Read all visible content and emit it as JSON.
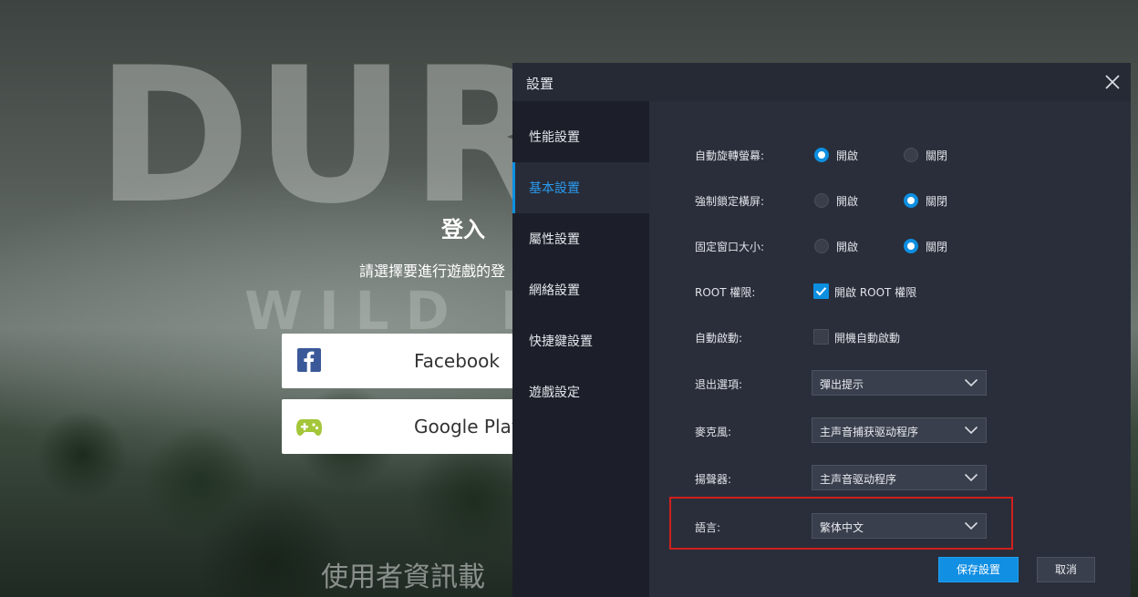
{
  "background": {
    "logo_text": "DURA",
    "logo_subtext": "WILD LA",
    "login_title": "登入",
    "login_subtitle": "請選擇要進行遊戲的登",
    "facebook_label": "Facebook",
    "google_play_label": "Google Play",
    "footer_text": "使用者資訊載"
  },
  "dialog": {
    "title": "設置",
    "sidebar": [
      {
        "label": "性能設置",
        "active": false
      },
      {
        "label": "基本設置",
        "active": true
      },
      {
        "label": "屬性設置",
        "active": false
      },
      {
        "label": "網絡設置",
        "active": false
      },
      {
        "label": "快捷鍵設置",
        "active": false
      },
      {
        "label": "遊戲設定",
        "active": false
      }
    ],
    "settings": {
      "auto_rotate": {
        "label": "自動旋轉螢幕:",
        "on": "開啟",
        "off": "關閉",
        "selected": "on"
      },
      "force_landscape": {
        "label": "強制鎖定橫屏:",
        "on": "開啟",
        "off": "關閉",
        "selected": "off"
      },
      "fixed_window": {
        "label": "固定窗口大小:",
        "on": "開啟",
        "off": "關閉",
        "selected": "off"
      },
      "root": {
        "label": "ROOT 權限:",
        "option": "開啟 ROOT 權限",
        "checked": true
      },
      "autostart": {
        "label": "自動啟動:",
        "option": "開機自動啟動",
        "checked": false
      },
      "exit_option": {
        "label": "退出選項:",
        "value": "彈出提示"
      },
      "microphone": {
        "label": "麥克風:",
        "value": "主声音捕获驱动程序"
      },
      "speaker": {
        "label": "揚聲器:",
        "value": "主声音驱动程序"
      },
      "language": {
        "label": "語言:",
        "value": "繁体中文"
      }
    },
    "save_label": "保存設置",
    "cancel_label": "取消"
  },
  "colors": {
    "accent": "#0d8fe0",
    "highlight_border": "#d0201c",
    "dialog_bg": "#2a2e3a",
    "sidebar_bg": "#1c1f29"
  }
}
